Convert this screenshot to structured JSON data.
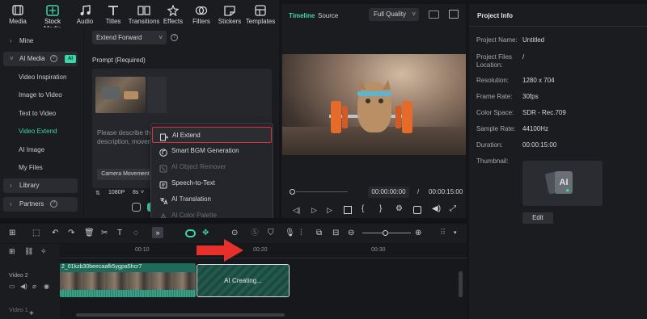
{
  "toolbar": {
    "items": [
      {
        "label": "Media",
        "icon": "media-icon"
      },
      {
        "label": "Stock Media",
        "icon": "stock-media-icon"
      },
      {
        "label": "Audio",
        "icon": "audio-icon"
      },
      {
        "label": "Titles",
        "icon": "titles-icon"
      },
      {
        "label": "Transitions",
        "icon": "transitions-icon"
      },
      {
        "label": "Effects",
        "icon": "effects-icon"
      },
      {
        "label": "Filters",
        "icon": "filters-icon"
      },
      {
        "label": "Stickers",
        "icon": "stickers-icon"
      },
      {
        "label": "Templates",
        "icon": "templates-icon"
      }
    ]
  },
  "sidebar": {
    "mine": "Mine",
    "ai_media": "AI Media",
    "ai_badge": "AI",
    "items": [
      "Video Inspiration",
      "Image to Video",
      "Text to Video",
      "Video Extend",
      "AI Image",
      "My Files"
    ],
    "library": "Library",
    "partners": "Partners"
  },
  "extend_panel": {
    "mode_select": "Extend Forward",
    "prompt_label": "Prompt (Required)",
    "placeholder_line1": "Please describe the c",
    "placeholder_line2": "description, moveme",
    "camera_movement": "Camera Movement",
    "resolution": "1080P",
    "duration": "8s"
  },
  "context_menu": {
    "items": [
      {
        "label": "AI Extend",
        "icon": "ai-extend-icon",
        "enabled": true,
        "highlighted": true
      },
      {
        "label": "Smart BGM Generation",
        "icon": "music-note-icon",
        "enabled": true
      },
      {
        "label": "AI Object Remover",
        "icon": "object-remover-icon",
        "enabled": false
      },
      {
        "label": "Speech-to-Text",
        "icon": "speech-to-text-icon",
        "enabled": true
      },
      {
        "label": "AI Translation",
        "icon": "translate-icon",
        "enabled": true
      },
      {
        "label": "AI Color Palette",
        "icon": "palette-icon",
        "enabled": false
      }
    ]
  },
  "player": {
    "tab_timeline": "Timeline",
    "tab_source": "Source",
    "quality": "Full Quality",
    "current_time": "00:00:00:00",
    "separator": "/",
    "total_time": "00:00:15:00"
  },
  "project_info": {
    "title": "Project Info",
    "fields": [
      {
        "label": "Project Name:",
        "value": "Untitled"
      },
      {
        "label": "Project Files Location:",
        "value": "/"
      },
      {
        "label": "Resolution:",
        "value": "1280 x 704"
      },
      {
        "label": "Frame Rate:",
        "value": "30fps"
      },
      {
        "label": "Color Space:",
        "value": "SDR - Rec.709"
      },
      {
        "label": "Sample Rate:",
        "value": "44100Hz"
      },
      {
        "label": "Duration:",
        "value": "00:00:15:00"
      }
    ],
    "thumbnail_label": "Thumbnail:",
    "thumbnail_text": "AI",
    "edit_button": "Edit"
  },
  "timeline": {
    "ruler": [
      "00:10",
      "00:20",
      "00:30"
    ],
    "track_video2": "Video 2",
    "track_video1": "Video 1",
    "clip_name": "2_01kzb30beecaafk5ygpa5hcr7",
    "ai_creating": "AI Creating..."
  },
  "colors": {
    "accent": "#3fd7a9",
    "highlight_border": "#d8343b",
    "arrow": "#e8302b",
    "clip_green": "#1f6b5b"
  }
}
